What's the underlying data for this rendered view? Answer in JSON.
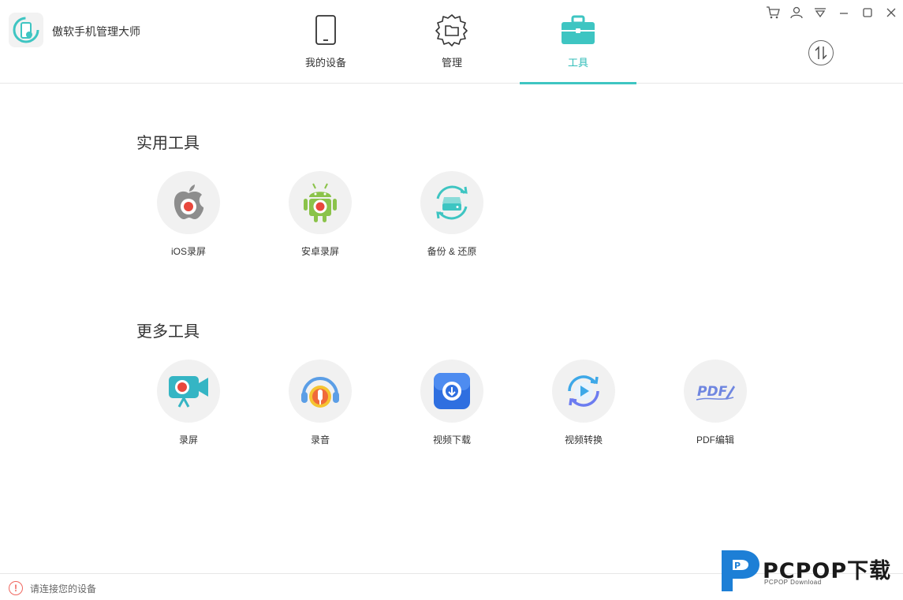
{
  "app": {
    "title": "傲软手机管理大师",
    "logo_icon": "phone-sync-logo-icon"
  },
  "nav": {
    "tabs": [
      {
        "label": "我的设备",
        "icon": "phone-icon",
        "active": false
      },
      {
        "label": "管理",
        "icon": "folder-gear-icon",
        "active": false
      },
      {
        "label": "工具",
        "icon": "toolbox-icon",
        "active": true
      }
    ]
  },
  "window_controls": [
    "cart-icon",
    "user-icon",
    "dropdown-menu-icon",
    "minimize-icon",
    "maximize-icon",
    "close-icon"
  ],
  "transfer_icon": "transfer-arrows-icon",
  "sections": {
    "utility": {
      "title": "实用工具",
      "tools": [
        {
          "label": "iOS录屏",
          "icon": "apple-record-icon"
        },
        {
          "label": "安卓录屏",
          "icon": "android-record-icon"
        },
        {
          "label": "备份 & 还原",
          "icon": "backup-restore-icon"
        }
      ]
    },
    "more": {
      "title": "更多工具",
      "tools": [
        {
          "label": "录屏",
          "icon": "screen-record-icon"
        },
        {
          "label": "录音",
          "icon": "audio-record-icon"
        },
        {
          "label": "视频下载",
          "icon": "video-download-icon"
        },
        {
          "label": "视频转换",
          "icon": "video-convert-icon"
        },
        {
          "label": "PDF编辑",
          "icon": "pdf-edit-icon"
        }
      ]
    }
  },
  "status": {
    "text": "请连接您的设备",
    "icon": "warning-icon"
  },
  "watermark": {
    "title": "PCPOP下载",
    "subtitle": "PCPOP Download",
    "logo_letter": "P"
  },
  "colors": {
    "accent": "#3ec5c2",
    "record_red": "#e8473d",
    "android_green": "#8bc34a",
    "status_red": "#f0675f"
  }
}
